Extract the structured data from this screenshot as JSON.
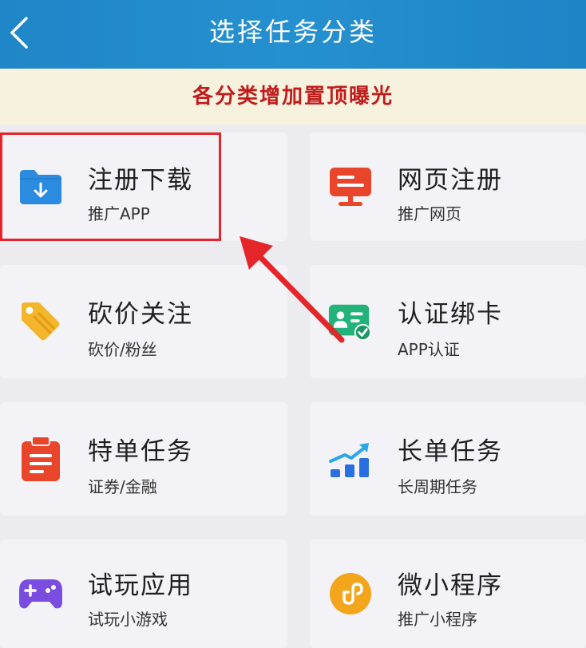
{
  "header": {
    "title": "选择任务分类",
    "back_icon": "chevron-left-icon"
  },
  "banner": {
    "text": "各分类增加置顶曝光"
  },
  "categories": [
    {
      "title": "注册下载",
      "sub": "推广APP",
      "icon": "download-folder-icon",
      "color": "#2a8be0"
    },
    {
      "title": "网页注册",
      "sub": "推广网页",
      "icon": "monitor-icon",
      "color": "#e8452b"
    },
    {
      "title": "砍价关注",
      "sub": "砍价/粉丝",
      "icon": "price-tag-icon",
      "color": "#f3b52b"
    },
    {
      "title": "认证绑卡",
      "sub": "APP认证",
      "icon": "id-card-icon",
      "color": "#22b37a"
    },
    {
      "title": "特单任务",
      "sub": "证券/金融",
      "icon": "clipboard-icon",
      "color": "#e8452b"
    },
    {
      "title": "长单任务",
      "sub": "长周期任务",
      "icon": "growth-chart-icon",
      "color": "#2a6fe0"
    },
    {
      "title": "试玩应用",
      "sub": "试玩小游戏",
      "icon": "gamepad-icon",
      "color": "#7a4de0"
    },
    {
      "title": "微小程序",
      "sub": "推广小程序",
      "icon": "mini-program-icon",
      "color": "#f3a51b"
    }
  ],
  "colors": {
    "header": "#2590cf",
    "banner_bg": "#f6f2dd",
    "banner_text": "#c01c1c",
    "highlight": "#e4262a"
  }
}
